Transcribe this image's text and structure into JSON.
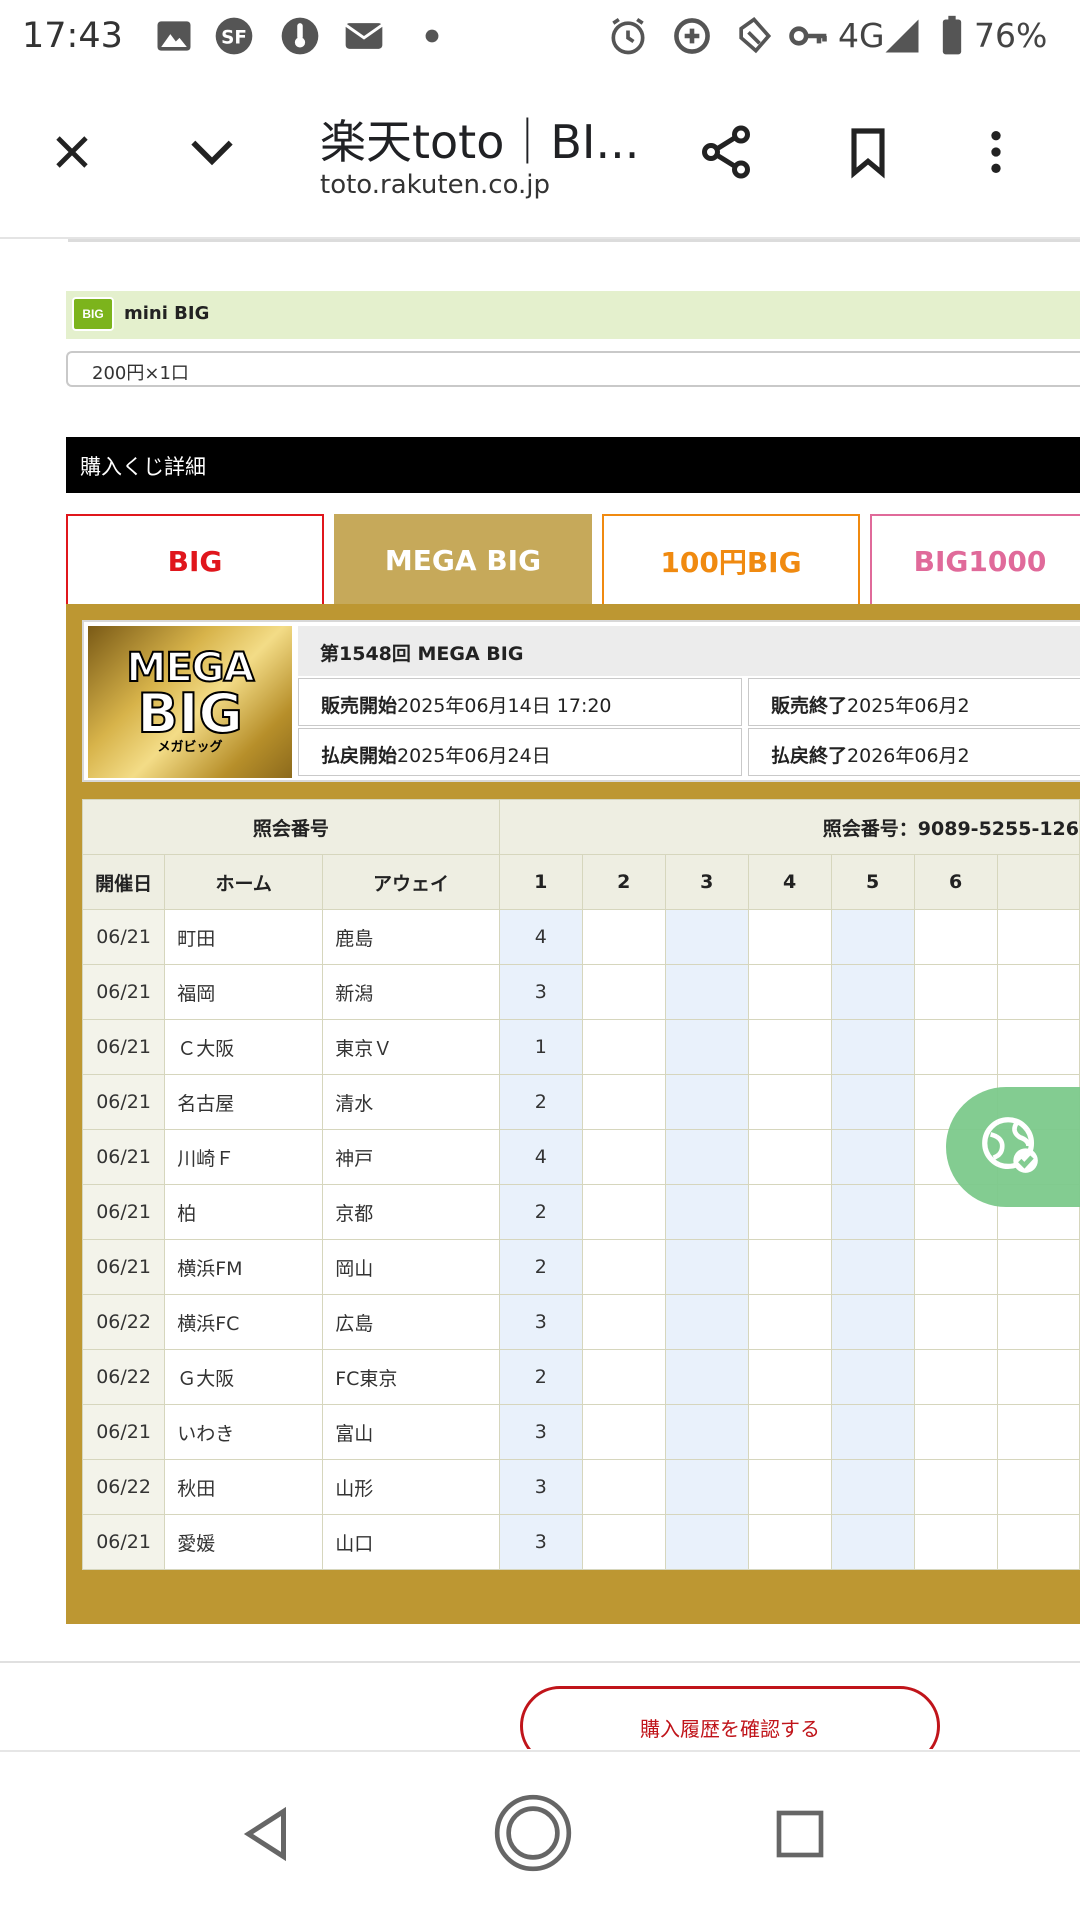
{
  "status_bar": {
    "time": "17:43",
    "network": "4G",
    "battery": "76%",
    "icons": [
      "image-icon",
      "sf-app-icon",
      "thermometer-icon",
      "au-mail-icon",
      "dot-icon",
      "alarm-icon",
      "data-saver-icon",
      "nfc-icon",
      "vpn-key-icon",
      "signal-icon",
      "battery-icon"
    ]
  },
  "browser": {
    "title": "楽天toto｜BI...",
    "domain": "toto.rakuten.co.jp",
    "icons": [
      "close-icon",
      "chevron-down-icon",
      "share-icon",
      "bookmark-icon",
      "more-vert-icon"
    ]
  },
  "mini_big": {
    "logo_text": "BIG",
    "label": "mini BIG",
    "price": "200円×1口"
  },
  "section_header": "購入くじ詳細",
  "tabs": {
    "big": "BIG",
    "mega_big": "MEGA BIG",
    "big100": "100円BIG",
    "big1000": "BIG1000"
  },
  "lottery": {
    "logo": {
      "line1": "MEGA",
      "line2": "BIG",
      "line3": "メガビッグ"
    },
    "title": "第1548回 MEGA BIG",
    "sale_start_label": "販売開始",
    "sale_start": "2025年06月14日 17:20",
    "sale_end_label": "販売終了",
    "sale_end": "2025年06月2",
    "payout_start_label": "払戻開始",
    "payout_start": "2025年06月24日",
    "payout_end_label": "払戻終了",
    "payout_end": "2026年06月2"
  },
  "table": {
    "ref_header_left": "照会番号",
    "ref_header_right": "照会番号：9089-5255-126",
    "col_date": "開催日",
    "col_home": "ホーム",
    "col_away": "アウェイ",
    "col_numbers": [
      "1",
      "2",
      "3",
      "4",
      "5",
      "6"
    ],
    "rows": [
      {
        "date": "06/21",
        "home": "町田",
        "away": "鹿島",
        "pick": "4"
      },
      {
        "date": "06/21",
        "home": "福岡",
        "away": "新潟",
        "pick": "3"
      },
      {
        "date": "06/21",
        "home": "Ｃ大阪",
        "away": "東京Ｖ",
        "pick": "1"
      },
      {
        "date": "06/21",
        "home": "名古屋",
        "away": "清水",
        "pick": "2"
      },
      {
        "date": "06/21",
        "home": "川崎Ｆ",
        "away": "神戸",
        "pick": "4"
      },
      {
        "date": "06/21",
        "home": "柏",
        "away": "京都",
        "pick": "2"
      },
      {
        "date": "06/21",
        "home": "横浜FM",
        "away": "岡山",
        "pick": "2"
      },
      {
        "date": "06/22",
        "home": "横浜FC",
        "away": "広島",
        "pick": "3"
      },
      {
        "date": "06/22",
        "home": "Ｇ大阪",
        "away": "FC東京",
        "pick": "2"
      },
      {
        "date": "06/21",
        "home": "いわき",
        "away": "富山",
        "pick": "3"
      },
      {
        "date": "06/22",
        "home": "秋田",
        "away": "山形",
        "pick": "3"
      },
      {
        "date": "06/21",
        "home": "愛媛",
        "away": "山口",
        "pick": "3"
      }
    ]
  },
  "history_button": "購入履歴を確認する",
  "nav_bar": {
    "icons": [
      "back-icon",
      "home-icon",
      "recents-icon"
    ]
  },
  "colors": {
    "gold": "#bd9732",
    "mega_tab": "#c6a95a",
    "big_red": "#e0161c",
    "orange": "#f08a10",
    "pink": "#e06a9a",
    "mini_green": "#e4f0cd"
  }
}
